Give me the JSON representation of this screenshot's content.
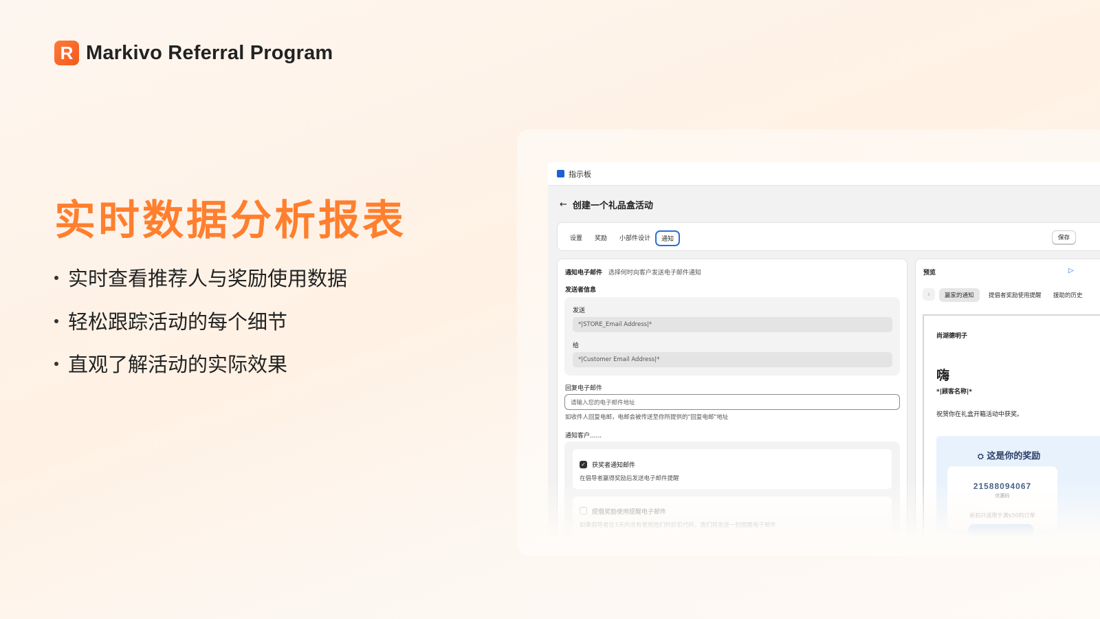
{
  "brand": {
    "logo_letter": "R",
    "name": "Markivo Referral Program",
    "accent": "#ff7f2e"
  },
  "headline": "实时数据分析报表",
  "bullets": [
    "实时查看推荐人与奖励使用数据",
    "轻松跟踪活动的每个细节",
    "直观了解活动的实际效果"
  ],
  "app": {
    "topbar_label": "指示板",
    "page_title": "创建一个礼品盒活动",
    "tabs": [
      "设置",
      "奖励",
      "小部件设计",
      "通知"
    ],
    "active_tab": "通知",
    "save_label": "保存",
    "notify": {
      "title": "通知电子邮件",
      "subtitle": "选择何时向客户发送电子邮件通知",
      "sender_section": "发送者信息",
      "from_label": "发送",
      "from_value": "*|STORE_Email Address|*",
      "to_label": "给",
      "to_value": "*|Customer Email Address|*",
      "reply_label": "回复电子邮件",
      "reply_placeholder": "请输入您的电子邮件地址",
      "reply_help": "如收件人回复电邮，电邮会被传送至你所提供的\"回复电邮\"地址",
      "notify_customers": "通知客户......",
      "option1_title": "获奖者通知邮件",
      "option1_desc": "在倡导者赢得奖励后发送电子邮件提醒",
      "option2_title": "提倡奖励使用提醒电子邮件",
      "option2_desc": "如果倡导者在3天内没有使用他们的折扣代码，我们将发送一封提醒电子邮件"
    },
    "preview": {
      "title": "预览",
      "play_icon": "play-icon",
      "tabs": [
        "赢家的通知",
        "提倡者奖励使用提醒",
        "援助的历史"
      ],
      "store_name": "尚湖德明子",
      "greeting": "嗨",
      "customer_name": "*|顾客名称|*",
      "congrats": "祝贺你在礼盒开箱活动中获奖。",
      "reward_title": "这是你的奖励",
      "coupon_code": "21588094067",
      "coupon_label": "优惠码",
      "coupon_note": "折扣只适用于满$50的订单"
    }
  }
}
